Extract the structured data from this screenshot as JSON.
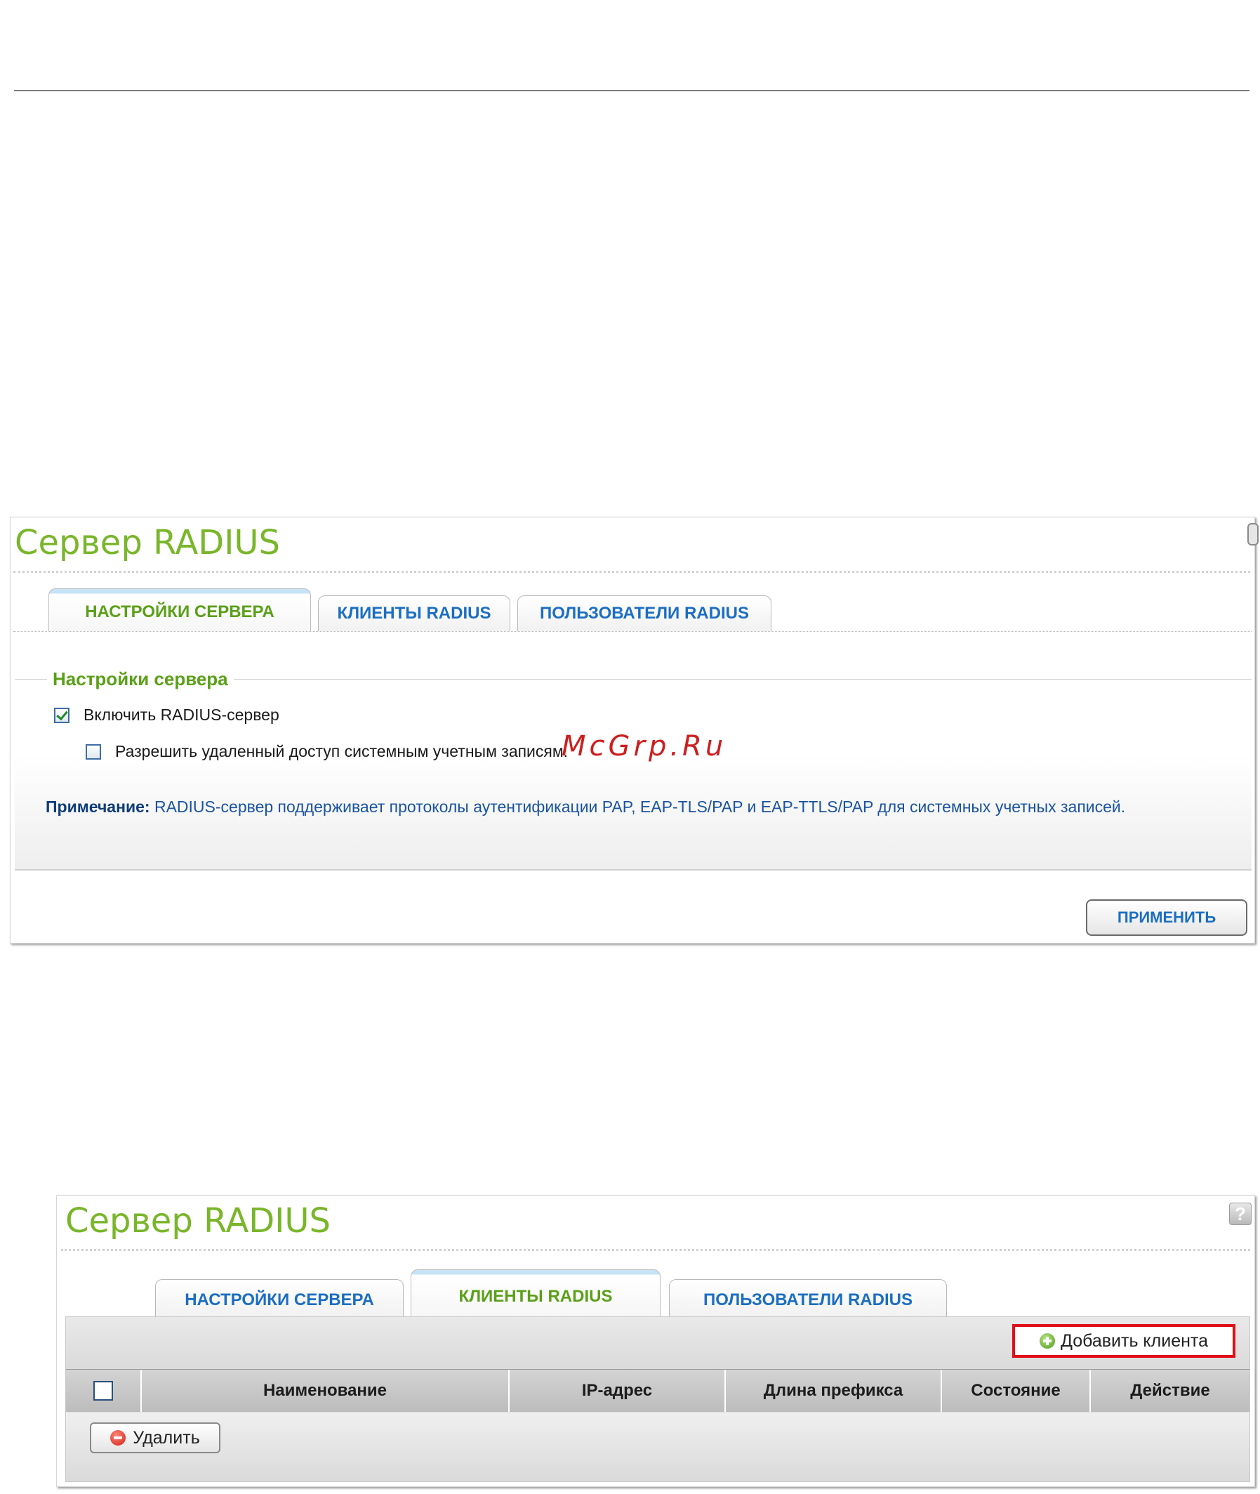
{
  "watermark": "McGrp.Ru",
  "panel1": {
    "title": "Сервер RADIUS",
    "tabs": [
      {
        "label": "НАСТРОЙКИ СЕРВЕРА",
        "active": true
      },
      {
        "label": "КЛИЕНТЫ RADIUS",
        "active": false
      },
      {
        "label": "ПОЛЬЗОВАТЕЛИ RADIUS",
        "active": false
      }
    ],
    "section_title": "Настройки сервера",
    "enable_label": "Включить RADIUS-сервер",
    "enable_checked": true,
    "remote_label": "Разрешить удаленный доступ системным учетным записям.",
    "remote_checked": false,
    "note_prefix": "Примечание:",
    "note_text": " RADIUS-сервер поддерживает протоколы аутентификации PAP, EAP-TLS/PAP и EAP-TTLS/PAP для системных учетных записей.",
    "apply_label": "ПРИМЕНИТЬ"
  },
  "panel2": {
    "title": "Сервер RADIUS",
    "help_label": "?",
    "tabs": [
      {
        "label": "НАСТРОЙКИ СЕРВЕРА",
        "active": false
      },
      {
        "label": "КЛИЕНТЫ RADIUS",
        "active": true
      },
      {
        "label": "ПОЛЬЗОВАТЕЛИ RADIUS",
        "active": false
      }
    ],
    "add_client_label": "Добавить клиента",
    "columns": [
      "Наименование",
      "IP-адрес",
      "Длина префикса",
      "Состояние",
      "Действие"
    ],
    "delete_label": "Удалить"
  },
  "icons": {
    "add": "plus-circle-icon",
    "delete": "minus-circle-icon",
    "help": "help-icon",
    "check": "checkmark-icon"
  },
  "colors": {
    "title_green": "#79b62a",
    "tab_blue": "#1b6ec2",
    "active_tab_green": "#5aa018",
    "highlight_red": "#e10f17"
  }
}
